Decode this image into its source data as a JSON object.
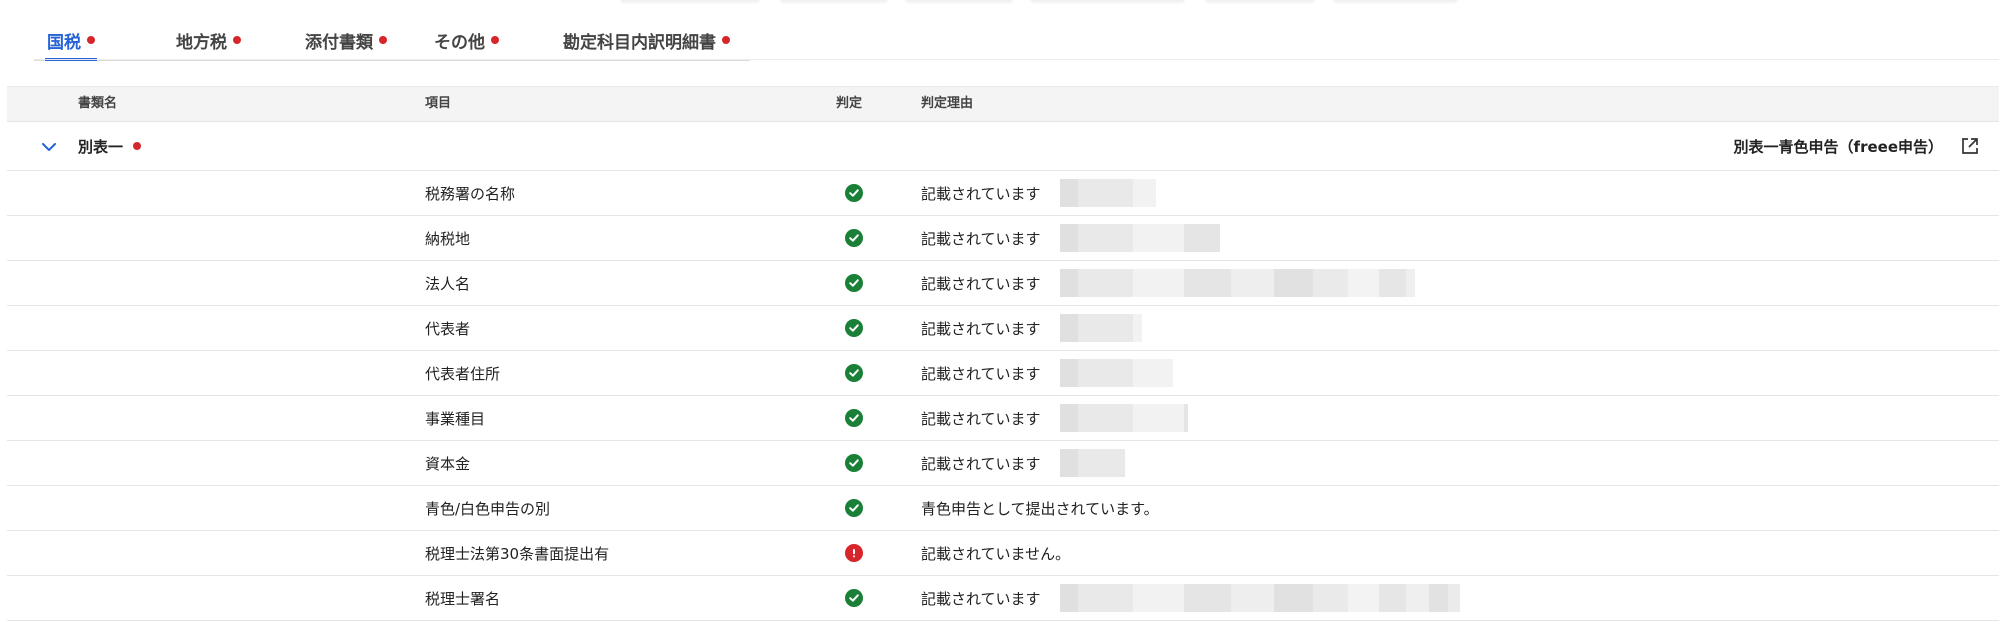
{
  "tabs": [
    {
      "label": "国税",
      "active": true,
      "has_alert": true
    },
    {
      "label": "地方税",
      "active": false,
      "has_alert": true
    },
    {
      "label": "添付書類",
      "active": false,
      "has_alert": true
    },
    {
      "label": "その他",
      "active": false,
      "has_alert": true
    },
    {
      "label": "勘定科目内訳明細書",
      "active": false,
      "has_alert": true
    }
  ],
  "table": {
    "headers": {
      "document": "書類名",
      "item": "項目",
      "judgment": "判定",
      "reason": "判定理由"
    },
    "group": {
      "name": "別表一",
      "has_alert": true,
      "expand_icon": "chevron-down-icon",
      "link_label": "別表一青色申告（freee申告）",
      "link_icon": "external-link-icon"
    },
    "rows": [
      {
        "item": "税務署の名称",
        "status": "ok",
        "reason": "記載されています",
        "redacted": true
      },
      {
        "item": "納税地",
        "status": "ok",
        "reason": "記載されています",
        "redacted": true
      },
      {
        "item": "法人名",
        "status": "ok",
        "reason": "記載されています",
        "redacted": true
      },
      {
        "item": "代表者",
        "status": "ok",
        "reason": "記載されています",
        "redacted": true
      },
      {
        "item": "代表者住所",
        "status": "ok",
        "reason": "記載されています",
        "redacted": true
      },
      {
        "item": "事業種目",
        "status": "ok",
        "reason": "記載されています",
        "redacted": true
      },
      {
        "item": "資本金",
        "status": "ok",
        "reason": "記載されています",
        "redacted": true
      },
      {
        "item": "青色/白色申告の別",
        "status": "ok",
        "reason": "青色申告として提出されています。",
        "redacted": false
      },
      {
        "item": "税理士法第30条書面提出有",
        "status": "warning",
        "reason": "記載されていません。",
        "redacted": false
      },
      {
        "item": "税理士署名",
        "status": "ok",
        "reason": "記載されています",
        "redacted": true
      }
    ]
  },
  "colors": {
    "accent": "#2563d6",
    "alert": "#d7262b",
    "ok": "#1a7f37",
    "header_bg": "#f5f4f4"
  }
}
